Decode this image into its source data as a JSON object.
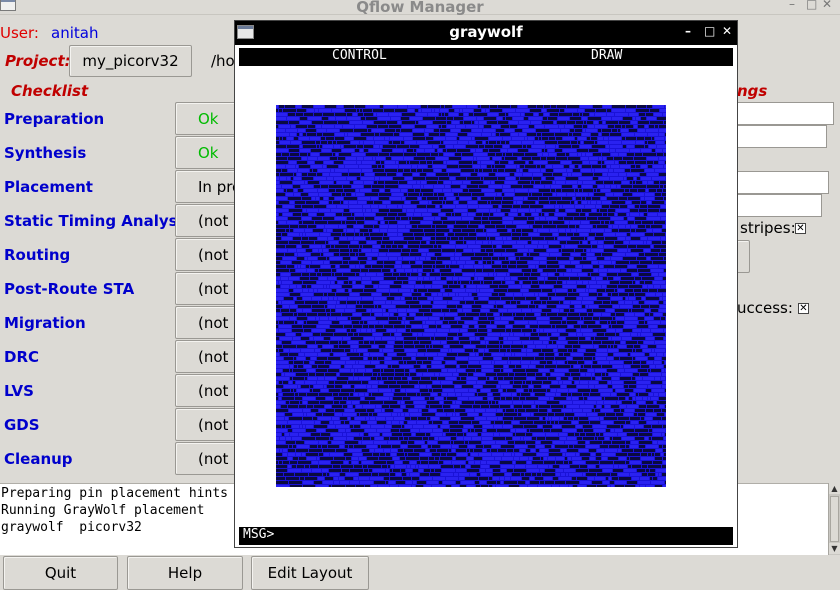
{
  "window": {
    "title": "Qflow Manager"
  },
  "user": {
    "label": "User:",
    "name": "anitah"
  },
  "project": {
    "label": "Project:",
    "name": "my_picorv32",
    "path": "/ho"
  },
  "checklist": {
    "title": "Checklist",
    "steps": [
      {
        "label": "Preparation",
        "status": "Ok",
        "status_color": "#00bb00"
      },
      {
        "label": "Synthesis",
        "status": "Ok",
        "status_color": "#00bb00"
      },
      {
        "label": "Placement",
        "status": "In pro",
        "status_color": "#000000"
      },
      {
        "label": "Static Timing Analysis",
        "status": "(not d",
        "status_color": "#000000"
      },
      {
        "label": "Routing",
        "status": "(not d",
        "status_color": "#000000"
      },
      {
        "label": "Post-Route STA",
        "status": "(not d",
        "status_color": "#000000"
      },
      {
        "label": "Migration",
        "status": "(not d",
        "status_color": "#000000"
      },
      {
        "label": "DRC",
        "status": "(not d",
        "status_color": "#000000"
      },
      {
        "label": "LVS",
        "status": "(not d",
        "status_color": "#000000"
      },
      {
        "label": "GDS",
        "status": "(not d",
        "status_color": "#000000"
      },
      {
        "label": "Cleanup",
        "status": "(not d",
        "status_color": "#000000"
      }
    ]
  },
  "settings": {
    "title_fragment": "ngs",
    "stripes_label": "stripes:",
    "success_label": "uccess:",
    "stripes_checked": "✕",
    "success_checked": "✕"
  },
  "console": {
    "lines": [
      "Preparing pin placement hints",
      "Running GrayWolf placement",
      "graywolf  picorv32"
    ]
  },
  "buttons": {
    "quit": "Quit",
    "help": "Help",
    "edit_layout": "Edit Layout"
  },
  "graywolf": {
    "title": "graywolf",
    "menu_control": "CONTROL",
    "menu_draw": "DRAW",
    "msg_prompt": "MSG>",
    "layout_color": "#1a12d8"
  },
  "icons": {
    "minimize": "minimize-icon",
    "maximize": "maximize-icon",
    "close": "close-icon"
  }
}
